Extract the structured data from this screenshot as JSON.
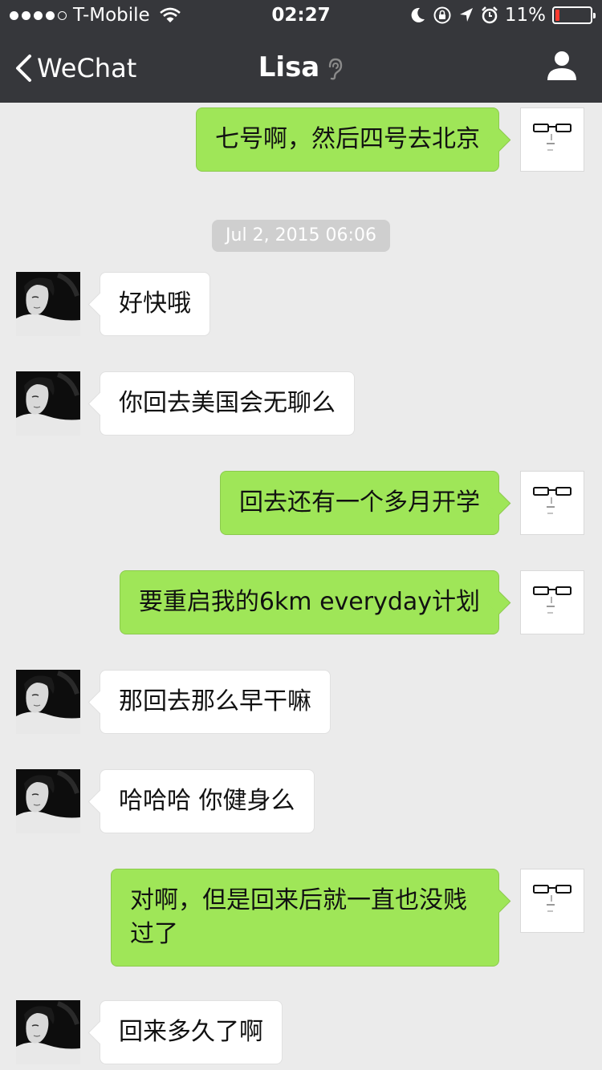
{
  "status_bar": {
    "carrier": "T-Mobile",
    "time": "02:27",
    "battery": "11%",
    "battery_level": 0.11,
    "icons": [
      "signal-dots",
      "wifi-icon",
      "moon-icon",
      "rotation-lock-icon",
      "location-arrow-icon",
      "alarm-icon",
      "battery-icon"
    ]
  },
  "nav": {
    "back_label": "WeChat",
    "title": "Lisa",
    "icons": [
      "chevron-left-icon",
      "ear-icon",
      "profile-icon"
    ]
  },
  "chat": {
    "timestamp": "Jul 2, 2015 06:06",
    "messages": [
      {
        "from": "me",
        "text": "七号啊，然后四号去北京"
      },
      {
        "from": "Lisa",
        "text": "好快哦"
      },
      {
        "from": "Lisa",
        "text": "你回去美国会无聊么"
      },
      {
        "from": "me",
        "text": "回去还有一个多月开学"
      },
      {
        "from": "me",
        "text": "要重启我的6km everyday计划"
      },
      {
        "from": "Lisa",
        "text": "那回去那么早干嘛"
      },
      {
        "from": "Lisa",
        "text": "哈哈哈 你健身么"
      },
      {
        "from": "me",
        "text": "对啊，但是回来后就一直也没贱过了"
      },
      {
        "from": "Lisa",
        "text": "回来多久了啊"
      }
    ]
  },
  "colors": {
    "nav_bg": "#36373b",
    "chat_bg": "#ebebeb",
    "outgoing_bubble": "#9fe658",
    "incoming_bubble": "#ffffff",
    "timestamp_bg": "#cfcfcf",
    "battery_low": "#ff3b30"
  }
}
